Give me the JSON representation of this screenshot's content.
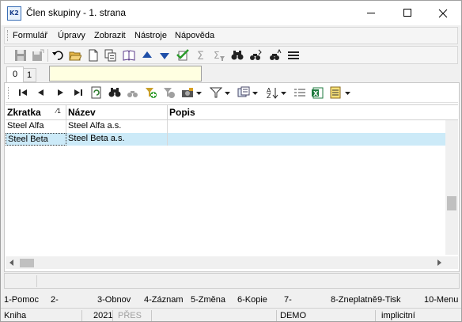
{
  "window": {
    "title": "Člen skupiny - 1. strana",
    "app_icon_text": "K2"
  },
  "menu": {
    "items": [
      "Formulář",
      "Úpravy",
      "Zobrazit",
      "Nástroje",
      "Nápověda"
    ]
  },
  "toolbar": {
    "icons": [
      "save-icon",
      "save-as-icon",
      "undo-icon",
      "open-folder-icon",
      "new-document-icon",
      "copy-icon",
      "book-icon",
      "arrow-up-icon",
      "arrow-down-icon",
      "check-icon",
      "sum-icon",
      "sum-filter-icon",
      "find-icon",
      "find-next-icon",
      "find-replace-icon",
      "menu-lines-icon"
    ]
  },
  "tabs": {
    "items": [
      "0",
      "1"
    ],
    "active": "0"
  },
  "grid": {
    "columns": [
      "Zkratka",
      "Název",
      "Popis"
    ],
    "sort_indicator": "1",
    "rows": [
      {
        "zkratka": "Steel Alfa",
        "nazev": "Steel Alfa a.s.",
        "popis": ""
      },
      {
        "zkratka": "Steel Beta",
        "nazev": "Steel Beta a.s.",
        "popis": ""
      }
    ],
    "selected_row": 1
  },
  "function_keys": [
    "1-Pomoc",
    "2-",
    "3-Obnov",
    "4-Záznam",
    "5-Změna",
    "6-Kopie",
    "7-",
    "8-Zneplatně",
    "9-Tisk",
    "10-Menu"
  ],
  "status": {
    "module": "Kniha",
    "year": "2021",
    "mode": "PŘES",
    "database": "DEMO",
    "state": "implicitní"
  },
  "colors": {
    "selected_row": "#cceaf8",
    "filter_box": "#ffffe1",
    "nav_blue": "#1f4fa8"
  }
}
